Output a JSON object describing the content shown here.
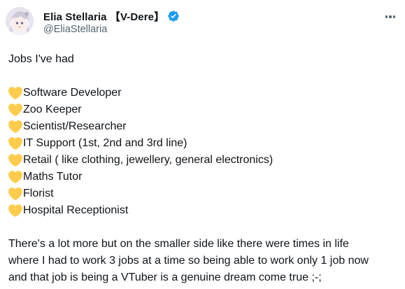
{
  "user": {
    "display_name": "Elia Stellaria 【V-Dere】",
    "handle": "@EliaStellaria",
    "verified_icon": "verified-badge-icon",
    "verified_color": "#1d9bf0"
  },
  "menu": {
    "icon": "more-options-icon"
  },
  "tweet": {
    "intro": "Jobs I've had",
    "bullet_icon": "yellow-heart-icon",
    "bullet_color": "#ffcc4d",
    "jobs": [
      "Software Developer",
      "Zoo Keeper",
      "Scientist/Researcher",
      "IT Support (1st, 2nd and 3rd line)",
      "Retail ( like clothing, jewellery, general electronics)",
      "Maths Tutor",
      "Florist",
      "Hospital Receptionist"
    ],
    "outro_lines": [
      "There's a lot more but on the smaller side like there were times in life",
      "where I had to work 3 jobs at a time so being able to work only 1 job now",
      "and that job is being a VTuber is a genuine dream come true ;-;"
    ]
  }
}
